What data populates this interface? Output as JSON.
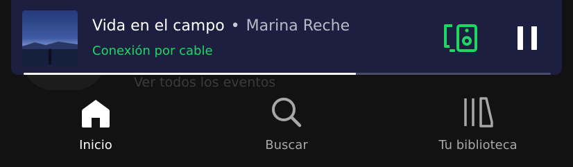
{
  "background": {
    "partial_text": "Ver todos los eventos"
  },
  "mini_player": {
    "track_title": "Vida en el campo",
    "separator": "•",
    "artist": "Marina Reche",
    "device_status": "Conexión por cable",
    "progress": 0.63,
    "colors": {
      "background": "#1c1f3f",
      "accent": "#1ed760"
    },
    "icons": {
      "device": "connected-device-speaker-icon",
      "playback": "pause-icon"
    }
  },
  "nav": {
    "items": [
      {
        "label": "Inicio",
        "icon": "home-icon",
        "active": true
      },
      {
        "label": "Buscar",
        "icon": "search-icon",
        "active": false
      },
      {
        "label": "Tu biblioteca",
        "icon": "library-icon",
        "active": false
      }
    ]
  }
}
